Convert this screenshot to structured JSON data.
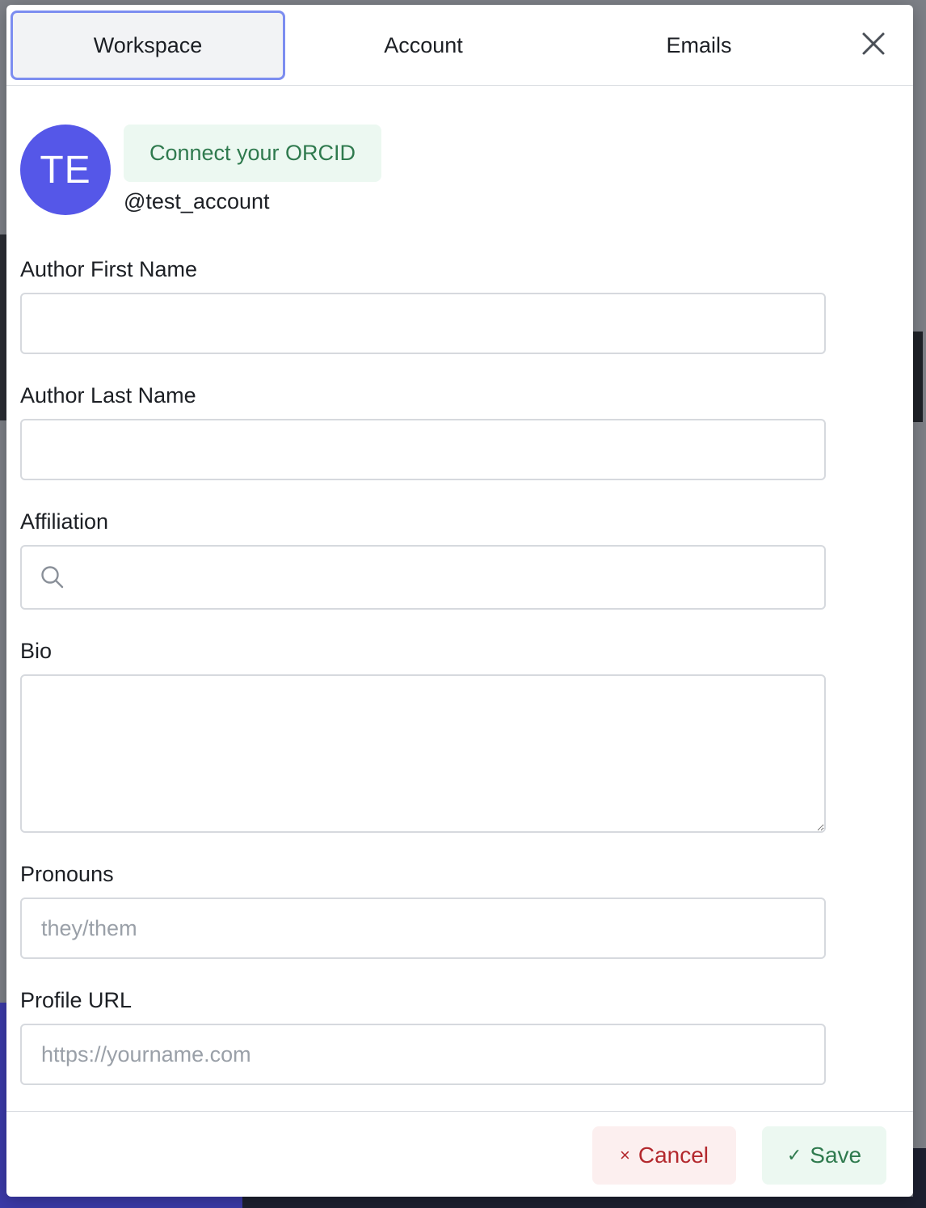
{
  "tabs": [
    {
      "label": "Workspace",
      "active": true
    },
    {
      "label": "Account",
      "active": false
    },
    {
      "label": "Emails",
      "active": false
    }
  ],
  "profile": {
    "avatar_initials": "TE",
    "avatar_color": "#5557e8",
    "orcid_button": "Connect your ORCID",
    "username": "@test_account"
  },
  "form": {
    "first_name": {
      "label": "Author First Name",
      "value": "",
      "placeholder": ""
    },
    "last_name": {
      "label": "Author Last Name",
      "value": "",
      "placeholder": ""
    },
    "affiliation": {
      "label": "Affiliation",
      "value": "",
      "placeholder": "",
      "icon": "search-icon"
    },
    "bio": {
      "label": "Bio",
      "value": "",
      "placeholder": ""
    },
    "pronouns": {
      "label": "Pronouns",
      "value": "",
      "placeholder": "they/them"
    },
    "profile_url": {
      "label": "Profile URL",
      "value": "",
      "placeholder": "https://yourname.com"
    }
  },
  "footer": {
    "cancel_label": "Cancel",
    "cancel_icon": "×",
    "save_label": "Save",
    "save_icon": "✓"
  },
  "colors": {
    "active_tab_border": "#7c8df0",
    "cancel_text": "#b3282d",
    "save_text": "#2f7a4e"
  }
}
